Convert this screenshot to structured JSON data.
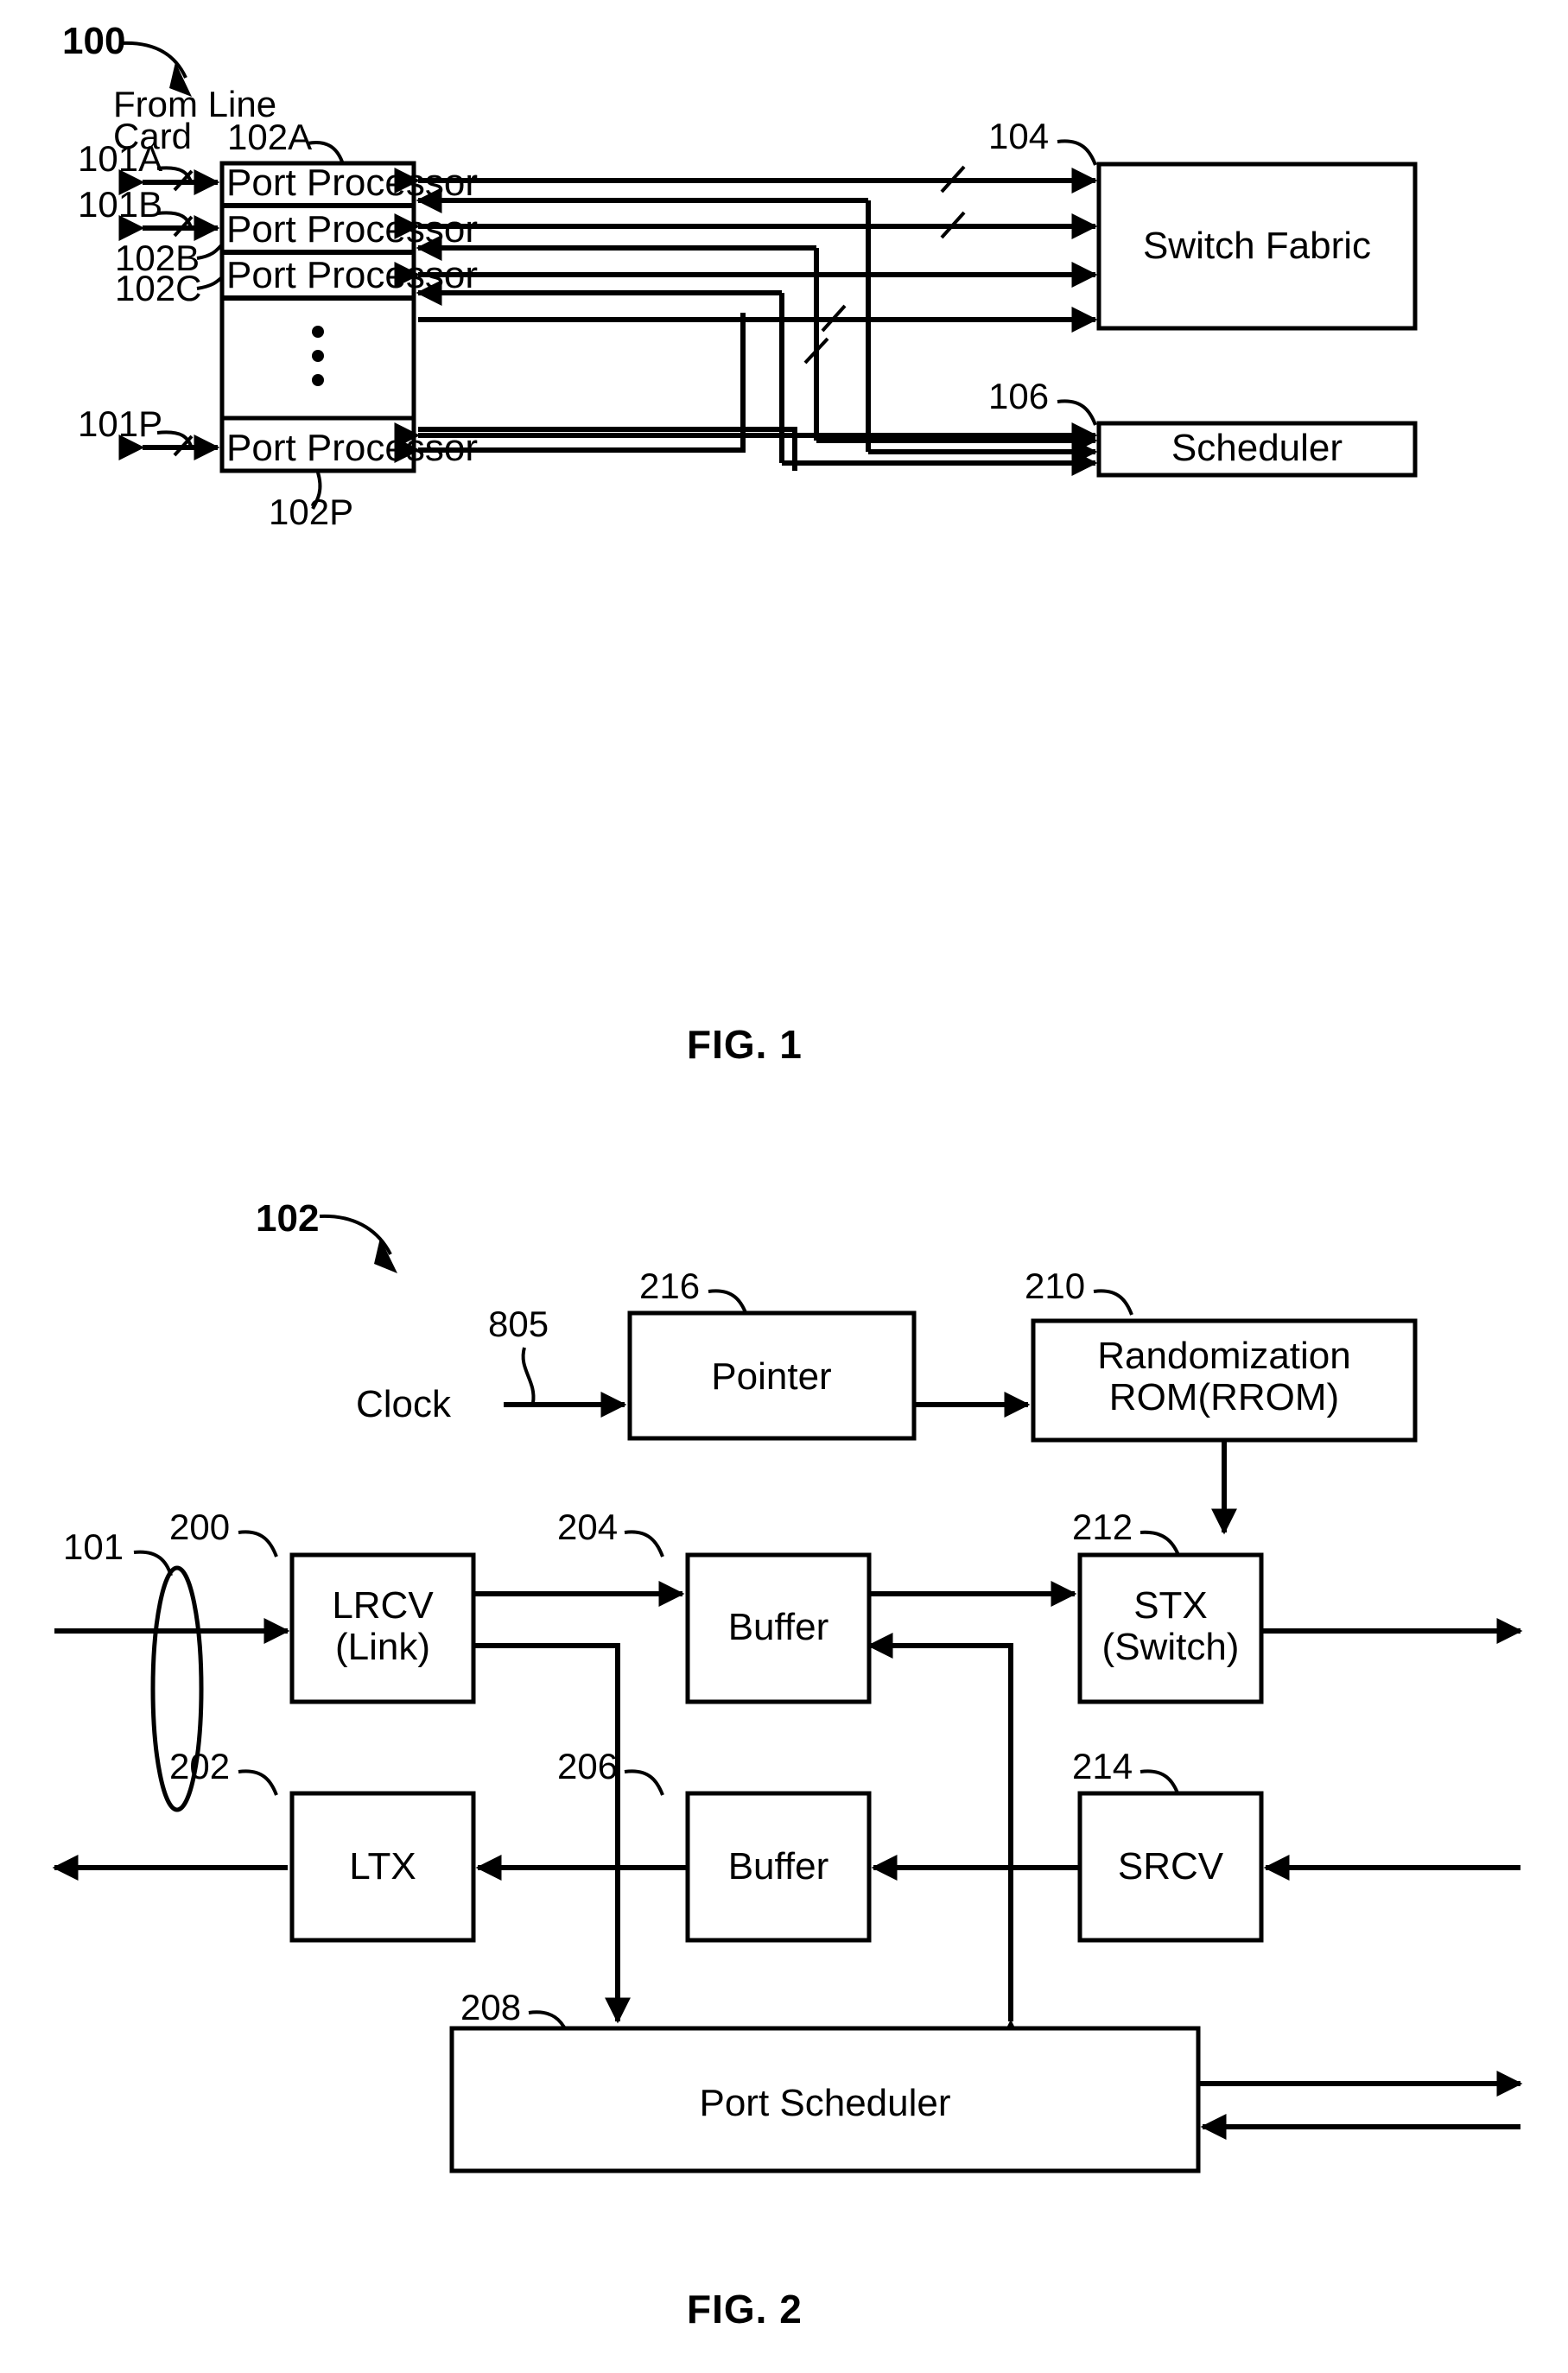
{
  "figures": [
    {
      "id": "fig1",
      "caption": "FIG. 1",
      "system_ref": "100",
      "annotations": {
        "from_line_card_line1": "From Line",
        "from_line_card_line2": "Card",
        "ref_101a": "101A",
        "ref_101b": "101B",
        "ref_101p": "101P",
        "ref_102a": "102A",
        "ref_102b": "102B",
        "ref_102c": "102C",
        "ref_102p": "102P",
        "ref_104": "104",
        "ref_106": "106"
      },
      "port_processors": [
        {
          "label": "Port Processor",
          "ref": "102A"
        },
        {
          "label": "Port Processor",
          "ref": "102B"
        },
        {
          "label": "Port Processor",
          "ref": "102C"
        },
        {
          "label": "Port Processor",
          "ref": "102P"
        }
      ],
      "blocks": [
        {
          "label": "Switch Fabric",
          "ref": "104"
        },
        {
          "label": "Scheduler",
          "ref": "106"
        }
      ],
      "ellipsis": "vertical-dots"
    },
    {
      "id": "fig2",
      "caption": "FIG. 2",
      "system_ref": "102",
      "annotations": {
        "clock_label": "Clock",
        "ref_805": "805",
        "ref_101": "101",
        "ref_200": "200",
        "ref_202": "202",
        "ref_204": "204",
        "ref_206": "206",
        "ref_208": "208",
        "ref_210": "210",
        "ref_212": "212",
        "ref_214": "214",
        "ref_216": "216"
      },
      "blocks": [
        {
          "ref": "216",
          "label": "Pointer",
          "lines": [
            "Pointer"
          ]
        },
        {
          "ref": "210",
          "label": "Randomization ROM(RROM)",
          "lines": [
            "Randomization",
            "ROM(RROM)"
          ]
        },
        {
          "ref": "200",
          "label": "LRCV (Link)",
          "lines": [
            "LRCV",
            "(Link)"
          ]
        },
        {
          "ref": "204",
          "label": "Buffer",
          "lines": [
            "Buffer"
          ]
        },
        {
          "ref": "212",
          "label": "STX (Switch)",
          "lines": [
            "STX",
            "(Switch)"
          ]
        },
        {
          "ref": "202",
          "label": "LTX",
          "lines": [
            "LTX"
          ]
        },
        {
          "ref": "206",
          "label": "Buffer",
          "lines": [
            "Buffer"
          ]
        },
        {
          "ref": "214",
          "label": "SRCV",
          "lines": [
            "SRCV"
          ]
        },
        {
          "ref": "208",
          "label": "Port Scheduler",
          "lines": [
            "Port Scheduler"
          ]
        }
      ]
    }
  ],
  "colors": {
    "ink": "#000000",
    "paper": "#ffffff"
  }
}
